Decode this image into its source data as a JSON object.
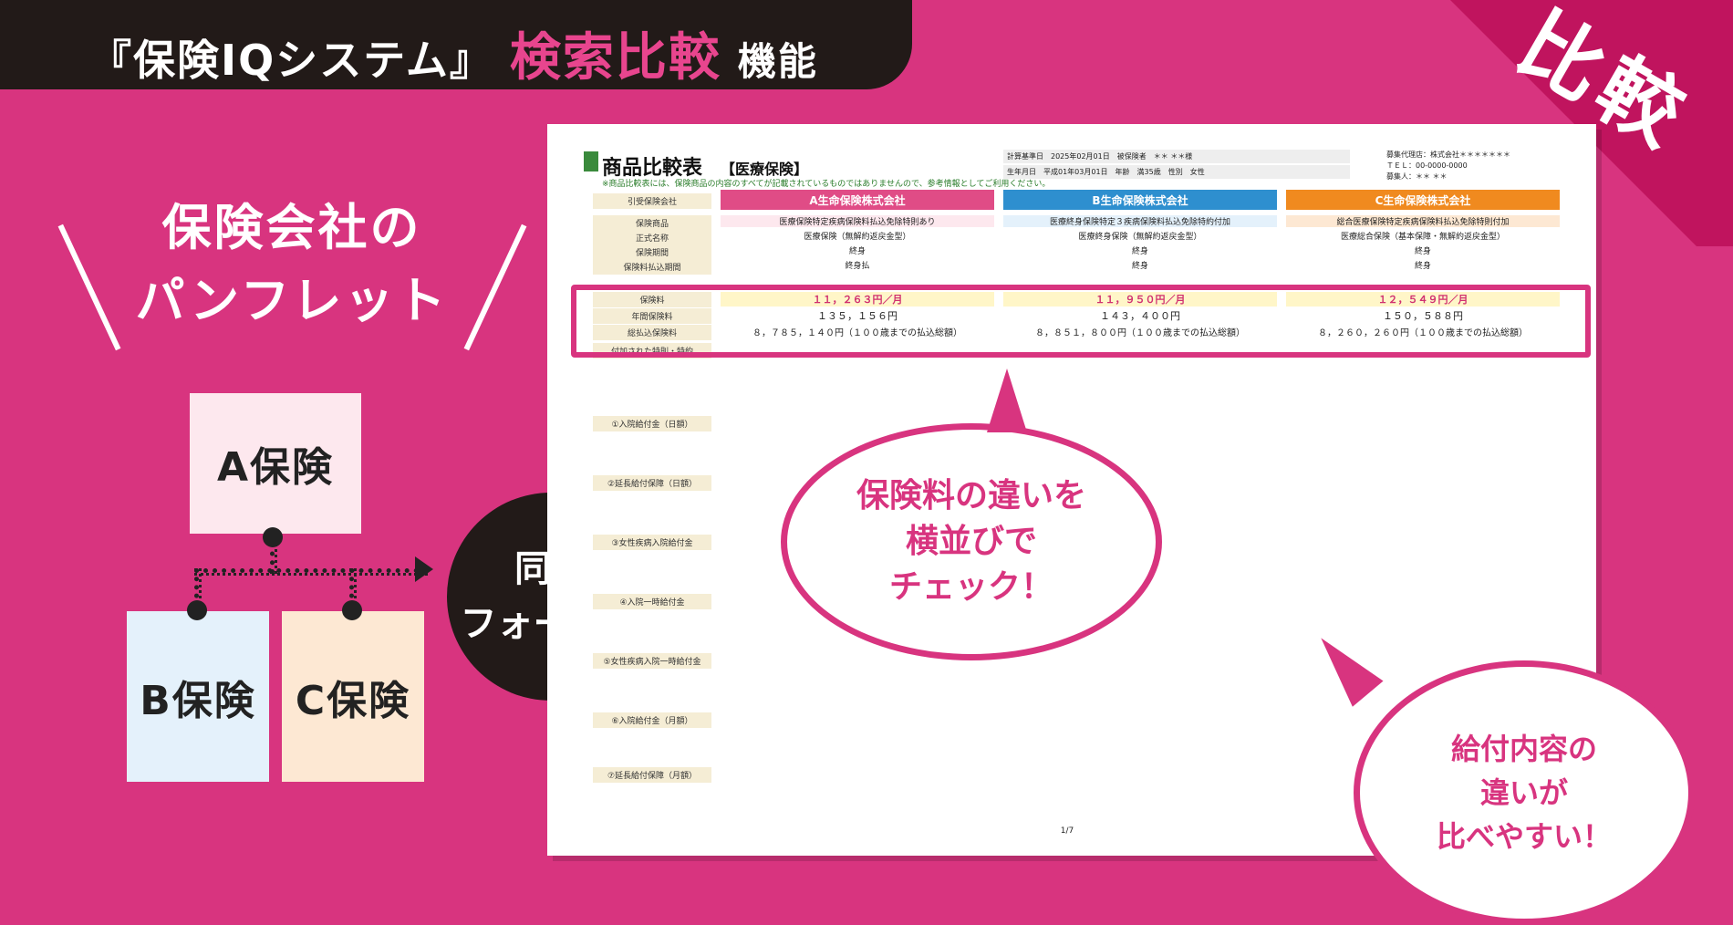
{
  "title": {
    "bracket_text": "『保険IQシステム』",
    "accent_text": "検索比較",
    "small_text": "機能"
  },
  "side_heading": {
    "line1": "保険会社の",
    "line2": "パンフレット"
  },
  "boxes": {
    "a": "A保険",
    "b": "B保険",
    "c": "C保険"
  },
  "same_form": {
    "line1": "同じ",
    "line2": "フォームに"
  },
  "stamp": "比較",
  "document": {
    "title": "商品比較表",
    "subtitle": "【医療保険】",
    "note": "※商品比較表には、保険商品の内容のすべてが記載されているものではありませんので、参考情報としてご利用ください。",
    "meta": {
      "date_label": "計算基準日",
      "date_value": "2025年02月01日",
      "insured_label": "被保険者",
      "insured_value": "＊＊ ＊＊様",
      "birth_label": "生年月日",
      "birth_value": "平成01年03月01日",
      "age_label": "年齢",
      "age_value": "満35歳",
      "sex_label": "性別",
      "sex_value": "女性"
    },
    "agent": {
      "l1": "募集代理店：株式会社＊＊＊＊＊＊＊",
      "l2": "ＴＥＬ：00-0000-0000",
      "l3": "募集人：＊＊ ＊＊"
    },
    "insurer_label": "引受保険会社",
    "companies": [
      "A生命保険株式会社",
      "B生命保険株式会社",
      "C生命保険株式会社"
    ],
    "row_labels": [
      "保険商品",
      "正式名称",
      "保険期間",
      "保険料払込期間",
      "保険料",
      "年間保険料",
      "総払込保険料",
      "付加された特則・特約"
    ],
    "products": [
      "医療保険特定疾病保険料払込免除特則あり",
      "医療終身保険特定３疾病保険料払込免除特約付加",
      "総合医療保険特定疾病保険料払込免除特則付加"
    ],
    "formal_names": [
      "医療保険（無解約返戻金型）",
      "医療終身保険（無解約返戻金型）",
      "医療総合保険（基本保障・無解約返戻金型）"
    ],
    "periods": [
      "終身",
      "終身",
      "終身"
    ],
    "pay_periods": [
      "終身払",
      "終身",
      "終身"
    ],
    "premiums": [
      "１１，２６３円／月",
      "１１，９５０円／月",
      "１２，５４９円／月"
    ],
    "annual": [
      "１３５，１５６円",
      "１４３，４００円",
      "１５０，５８８円"
    ],
    "total": [
      "８，７８５，１４０円（１００歳までの払込総額）",
      "８，８５１，８００円（１００歳までの払込総額）",
      "８，２６０，２６０円（１００歳までの払込総額）"
    ],
    "benefit_labels": [
      "①入院給付金（日額）",
      "②延長給付保障（日額）",
      "③女性疾病入院給付金",
      "④入院一時給付金",
      "⑤女性疾病入院一時給付金",
      "⑥入院給付金（月額）",
      "⑦延長給付保障（月額）"
    ],
    "page": "1/7"
  },
  "bubble1": {
    "line1": "保険料の違いを",
    "line2": "横並びで",
    "line3": "チェック！"
  },
  "bubble2": {
    "line1": "給付内容の",
    "line2": "違いが",
    "line3": "比べやすい！"
  },
  "colors": {
    "background": "#d8347f",
    "dark": "#221a18",
    "accent": "#e8458e"
  }
}
